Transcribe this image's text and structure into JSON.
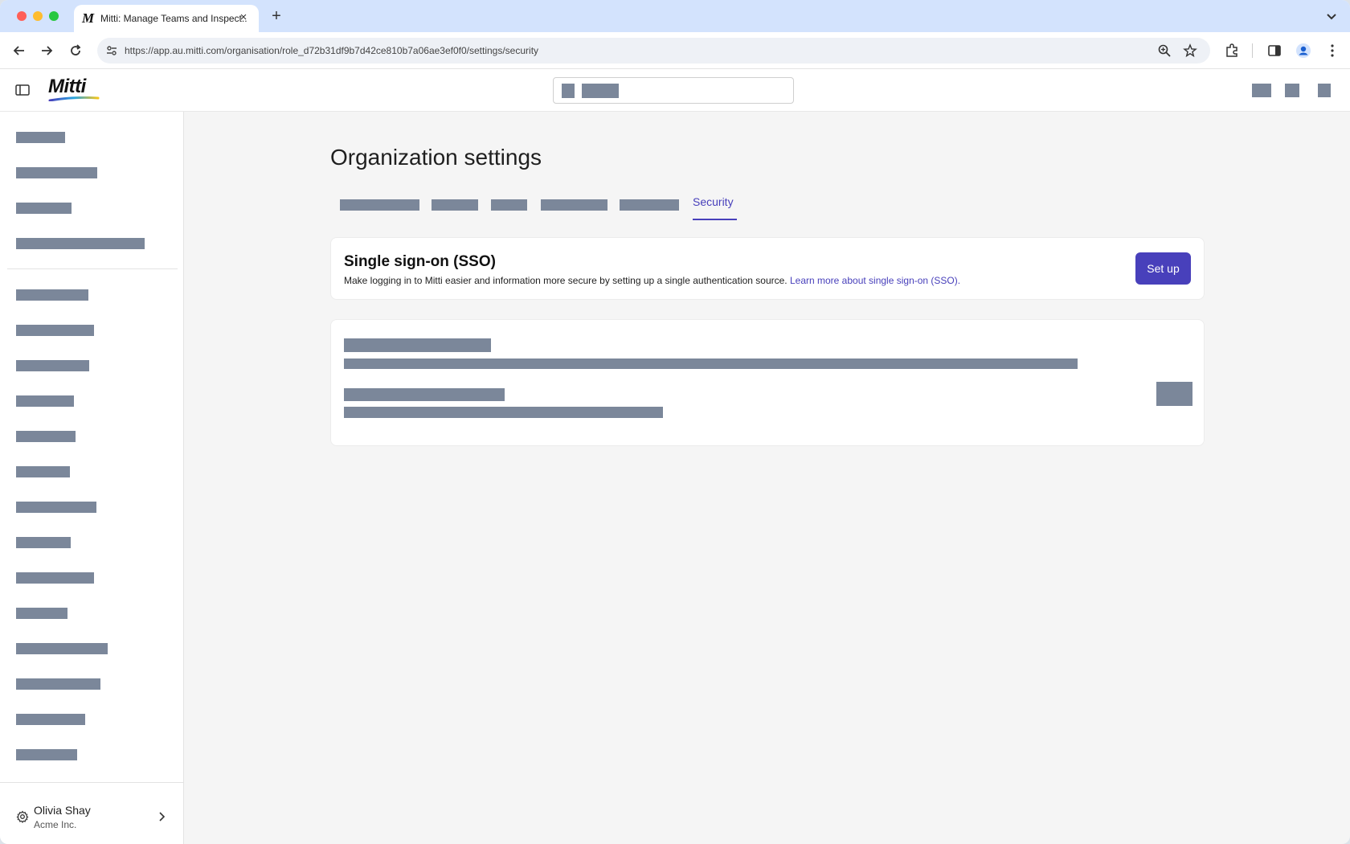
{
  "browser": {
    "tab_title": "Mitti: Manage Teams and Inspect...",
    "tab_favicon": "M",
    "url": "https://app.au.mitti.com/organisation/role_d72b31df9b7d42ce810b7a06ae3ef0f0/settings/security"
  },
  "app": {
    "logo_text": "Mitti"
  },
  "page": {
    "title": "Organization settings",
    "active_tab": "Security"
  },
  "sso": {
    "title": "Single sign-on (SSO)",
    "description": "Make logging in to Mitti easier and information more secure by setting up a single authentication source.",
    "link_text": "Learn more about single sign-on (SSO).",
    "button_label": "Set up"
  },
  "sidebar": {
    "user_name": "Olivia Shay",
    "org_name": "Acme Inc."
  },
  "colors": {
    "accent": "#4840bb",
    "redacted": "#7b879a"
  }
}
